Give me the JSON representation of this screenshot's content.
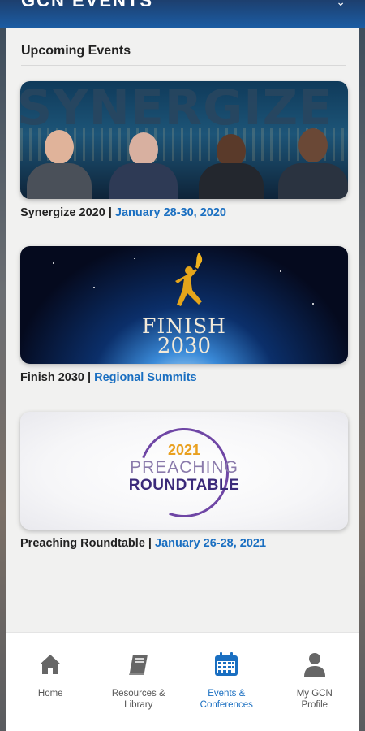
{
  "app": {
    "title": "GCN EVENTS"
  },
  "section": {
    "title": "Upcoming Events"
  },
  "events": [
    {
      "name": "Synergize 2020",
      "separator": " | ",
      "detail": "January 28-30, 2020",
      "banner_word": "SYNERGIZE"
    },
    {
      "name": "Finish 2030",
      "separator": " | ",
      "detail": "Regional Summits",
      "banner_title": "FINISH",
      "banner_year": "2030"
    },
    {
      "name": "Preaching Roundtable",
      "separator": " | ",
      "detail": "January 26-28, 2021",
      "banner_year": "2021",
      "banner_line1": "PREACHING",
      "banner_line2": "ROUNDTABLE"
    }
  ],
  "nav": [
    {
      "label": "Home",
      "icon": "home-icon",
      "active": false
    },
    {
      "label": "Resources &\nLibrary",
      "icon": "book-icon",
      "active": false
    },
    {
      "label": "Events &\nConferences",
      "icon": "calendar-icon",
      "active": true
    },
    {
      "label": "My GCN\nProfile",
      "icon": "person-icon",
      "active": false
    }
  ],
  "colors": {
    "accent": "#1a6fc1",
    "header": "#1b5ca3",
    "nav_inactive": "#555555"
  }
}
